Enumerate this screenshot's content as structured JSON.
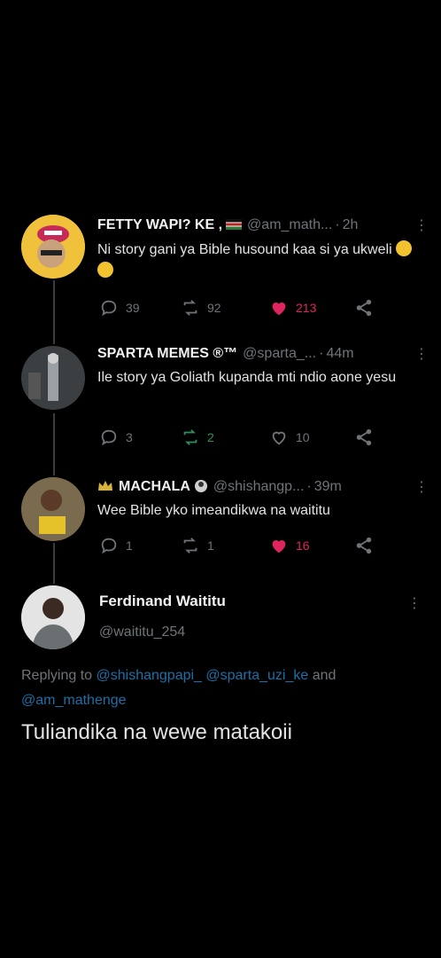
{
  "tweets": [
    {
      "name": "FETTY WAPI? KE ,",
      "badge": "",
      "handle": "@am_math...",
      "time": "2h",
      "text": "Ni story gani ya Bible husound kaa si ya ukweli",
      "counts": {
        "reply": "39",
        "retweet": "92",
        "like": "213"
      },
      "liked": true,
      "retweeted": false
    },
    {
      "name": "SPARTA MEMES ®™",
      "badge": "",
      "handle": "@sparta_...",
      "time": "44m",
      "text": "Ile story ya Goliath kupanda mti ndio aone yesu",
      "counts": {
        "reply": "3",
        "retweet": "2",
        "like": "10"
      },
      "liked": false,
      "retweeted": true
    },
    {
      "name": "MACHALA",
      "badge": "",
      "handle": "@shishangp...",
      "time": "39m",
      "text": "Wee Bible yko imeandikwa na waititu",
      "counts": {
        "reply": "1",
        "retweet": "1",
        "like": "16"
      },
      "liked": true,
      "retweeted": false
    }
  ],
  "main_tweet": {
    "name": "Ferdinand Waititu",
    "handle": "@waititu_254",
    "replying_prefix": "Replying to",
    "replying_to": [
      "@shishangpapi_",
      "@sparta_uzi_ke",
      "@am_mathenge"
    ],
    "replying_and": "and",
    "text": "Tuliandika na wewe matakoii"
  },
  "colors": {
    "background": "#000000",
    "like": "#e0245e",
    "retweet": "#2f8f5a",
    "link": "#1d6fa5",
    "muted": "#6f7479"
  }
}
